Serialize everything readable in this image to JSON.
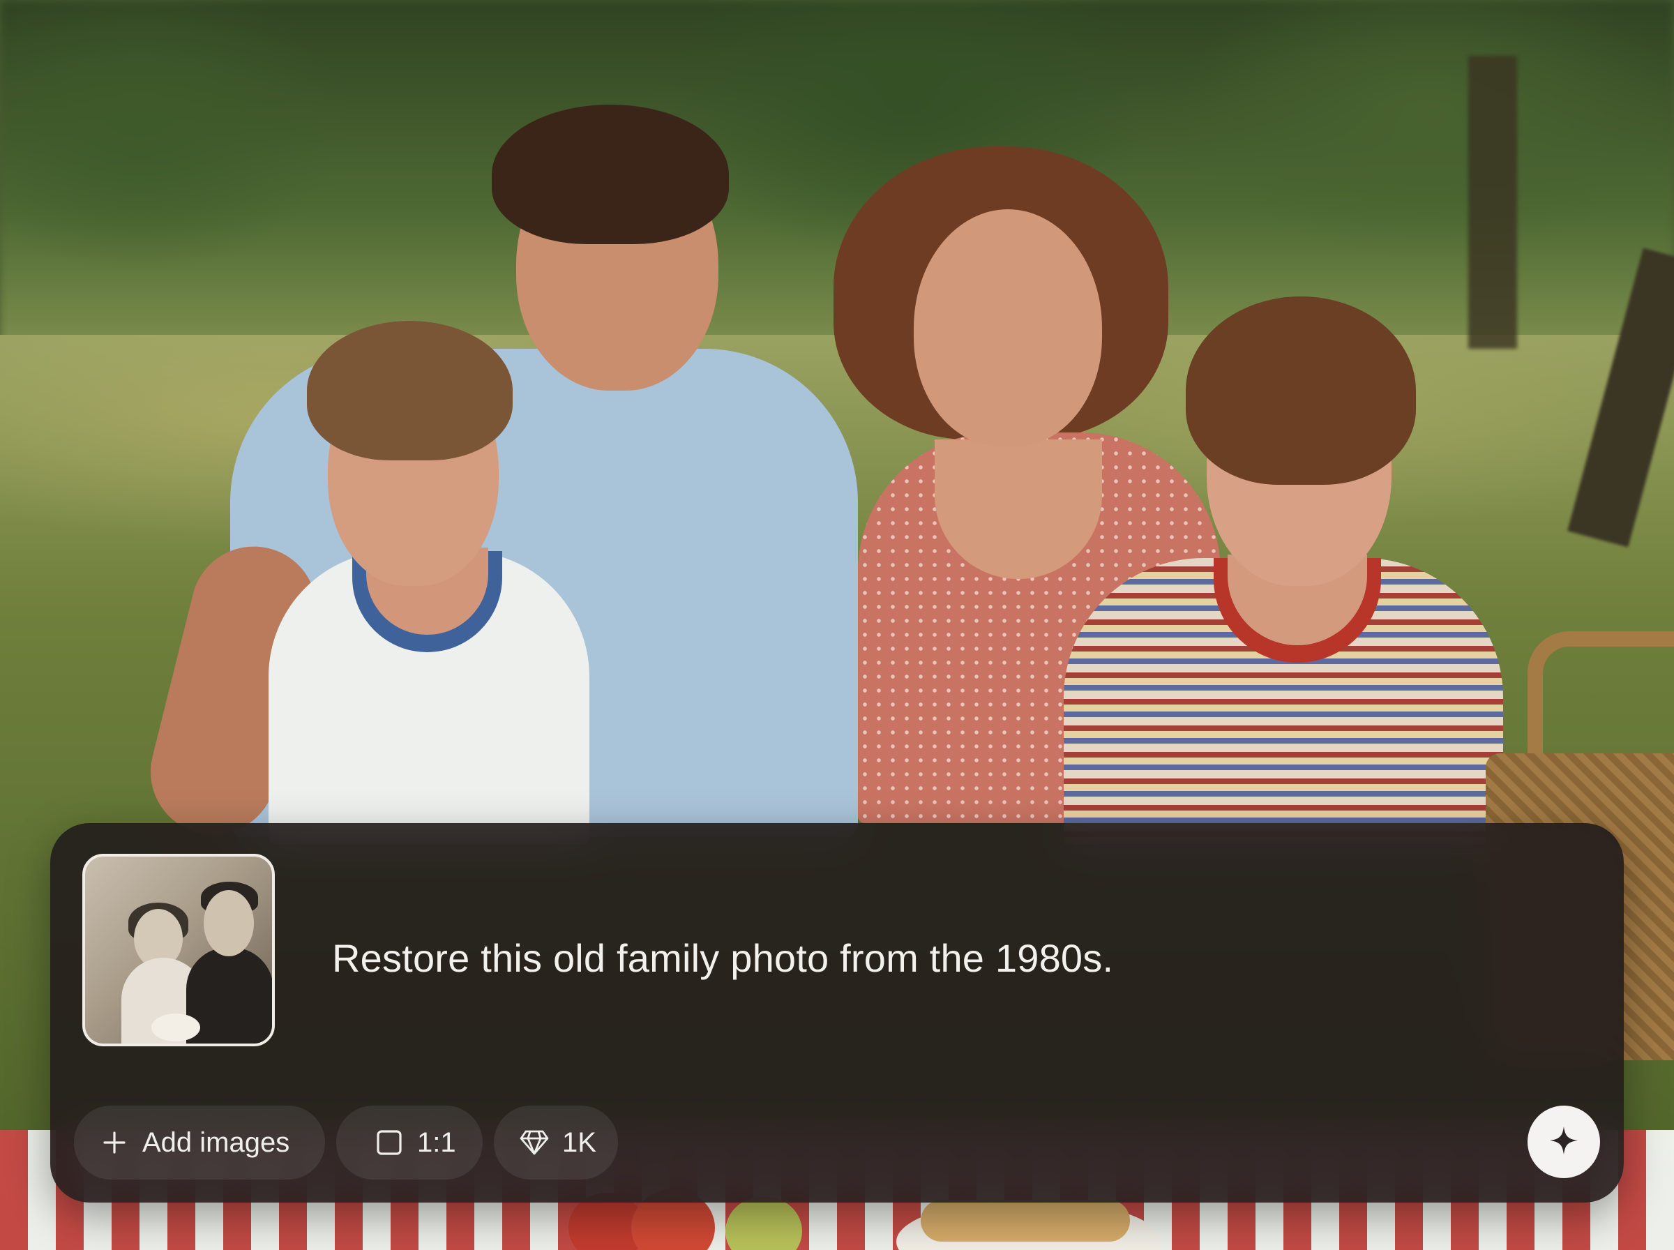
{
  "prompt": {
    "text": "Restore this old family photo from the 1980s.",
    "attachment_icon": "vintage-photo-thumbnail"
  },
  "toolbar": {
    "add_images_label": "Add images",
    "add_images_icon": "plus-icon",
    "aspect_ratio_label": "1:1",
    "aspect_ratio_icon": "square-icon",
    "resolution_label": "1K",
    "resolution_icon": "diamond-icon",
    "generate_icon": "sparkle-icon"
  },
  "colors": {
    "panel_bg": "#221c1c",
    "text": "#f3f1ee",
    "send_button_bg": "#f4f3f1"
  }
}
